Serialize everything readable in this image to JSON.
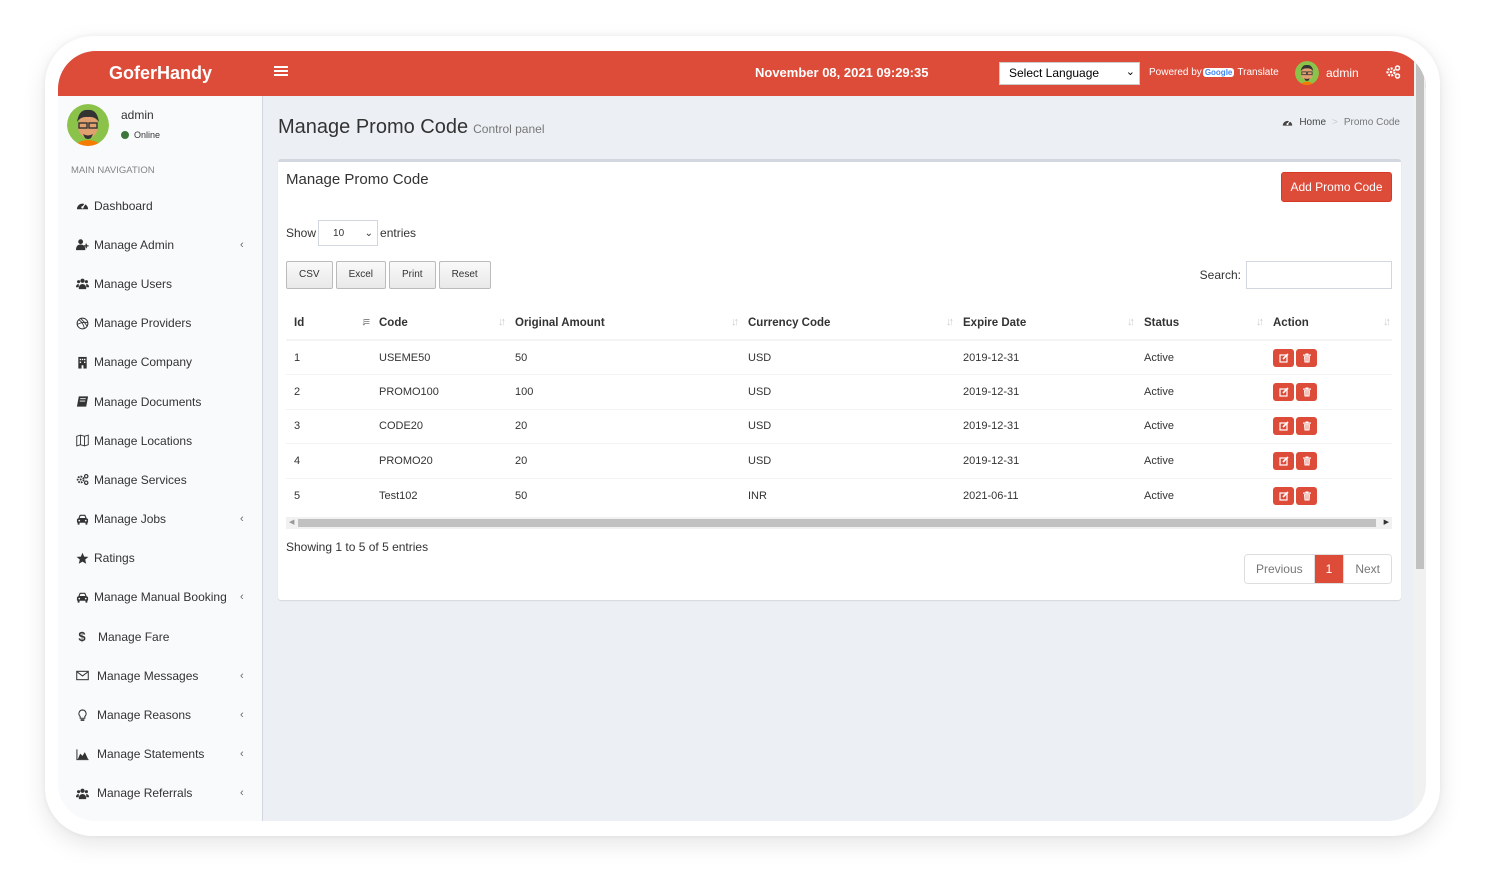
{
  "app": {
    "brand": "GoferHandy",
    "datetime": "November 08, 2021 09:29:35"
  },
  "header": {
    "language_select": "Select Language",
    "powered_by": "Powered by",
    "google": "Google",
    "translate": "Translate",
    "user": "admin",
    "accent_color": "#dd4b39"
  },
  "sidebar": {
    "user_name": "admin",
    "user_status": "Online",
    "nav_header": "MAIN NAVIGATION",
    "items": [
      {
        "label": "Dashboard",
        "icon": "dashboard-icon",
        "has_submenu": false
      },
      {
        "label": "Manage Admin",
        "icon": "user-plus-icon",
        "has_submenu": true
      },
      {
        "label": "Manage Users",
        "icon": "users-icon",
        "has_submenu": false
      },
      {
        "label": "Manage Providers",
        "icon": "dribbble-icon",
        "has_submenu": false
      },
      {
        "label": "Manage Company",
        "icon": "building-icon",
        "has_submenu": false
      },
      {
        "label": "Manage Documents",
        "icon": "book-icon",
        "has_submenu": false
      },
      {
        "label": "Manage Locations",
        "icon": "map-icon",
        "has_submenu": false
      },
      {
        "label": "Manage Services",
        "icon": "gears-icon",
        "has_submenu": false
      },
      {
        "label": "Manage Jobs",
        "icon": "taxi-icon",
        "has_submenu": true
      },
      {
        "label": "Ratings",
        "icon": "star-icon",
        "has_submenu": false
      },
      {
        "label": "Manage Manual Booking",
        "icon": "taxi-icon",
        "has_submenu": true
      },
      {
        "label": "Manage Fare",
        "icon": "dollar-icon",
        "has_submenu": false
      },
      {
        "label": "Manage Messages",
        "icon": "envelope-icon",
        "has_submenu": true
      },
      {
        "label": "Manage Reasons",
        "icon": "lightbulb-icon",
        "has_submenu": true
      },
      {
        "label": "Manage Statements",
        "icon": "area-chart-icon",
        "has_submenu": true
      },
      {
        "label": "Manage Referrals",
        "icon": "users-icon",
        "has_submenu": true
      }
    ]
  },
  "page": {
    "title": "Manage Promo Code",
    "subtitle": "Control panel",
    "breadcrumb": {
      "home": "Home",
      "current": "Promo Code"
    }
  },
  "box": {
    "title": "Manage Promo Code",
    "add_button": "Add Promo Code",
    "show_label": "Show",
    "entries_label": "entries",
    "page_length": "10",
    "export_buttons": [
      "CSV",
      "Excel",
      "Print",
      "Reset"
    ],
    "search_label": "Search:",
    "search_value": "",
    "columns": [
      "Id",
      "Code",
      "Original Amount",
      "Currency Code",
      "Expire Date",
      "Status",
      "Action"
    ],
    "rows": [
      {
        "id": "1",
        "code": "USEME50",
        "amount": "50",
        "currency": "USD",
        "expire": "2019-12-31",
        "status": "Active"
      },
      {
        "id": "2",
        "code": "PROMO100",
        "amount": "100",
        "currency": "USD",
        "expire": "2019-12-31",
        "status": "Active"
      },
      {
        "id": "3",
        "code": "CODE20",
        "amount": "20",
        "currency": "USD",
        "expire": "2019-12-31",
        "status": "Active"
      },
      {
        "id": "4",
        "code": "PROMO20",
        "amount": "20",
        "currency": "USD",
        "expire": "2019-12-31",
        "status": "Active"
      },
      {
        "id": "5",
        "code": "Test102",
        "amount": "50",
        "currency": "INR",
        "expire": "2021-06-11",
        "status": "Active"
      }
    ],
    "info": "Showing 1 to 5 of 5 entries",
    "pagination": {
      "previous": "Previous",
      "current": "1",
      "next": "Next"
    }
  }
}
